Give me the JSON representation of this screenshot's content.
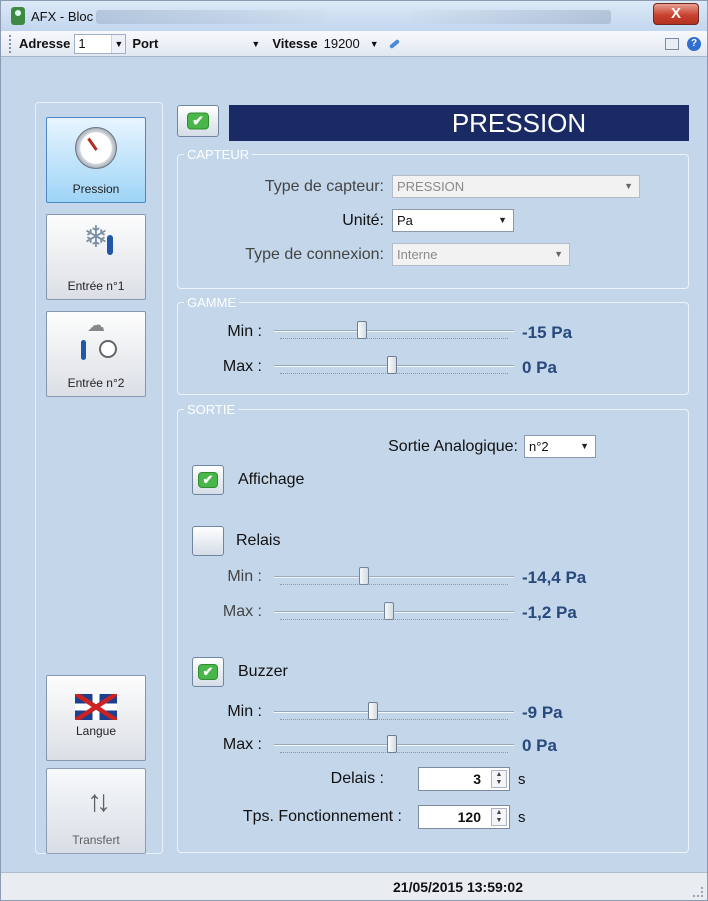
{
  "window": {
    "title": "AFX - Bloc",
    "close_label": "X"
  },
  "toolbar": {
    "adresse_label": "Adresse",
    "adresse_value": "1",
    "port_label": "Port",
    "port_value": "",
    "vitesse_label": "Vitesse",
    "vitesse_value": "19200"
  },
  "sidebar": {
    "items": [
      {
        "label": "Pression",
        "icon": "pressure-gauge-icon",
        "active": true
      },
      {
        "label": "Entrée n°1",
        "icon": "snowflake-thermometer-icon"
      },
      {
        "label": "Entrée n°2",
        "icon": "weather-thermometer-gauge-icon"
      }
    ],
    "langue_label": "Langue",
    "transfert_label": "Transfert"
  },
  "header": {
    "title": "PRESSION",
    "enabled": true
  },
  "capteur": {
    "group_title": "CAPTEUR",
    "type_capteur_label": "Type de capteur:",
    "type_capteur_value": "PRESSION",
    "unite_label": "Unité:",
    "unite_value": "Pa",
    "type_connexion_label": "Type de connexion:",
    "type_connexion_value": "Interne"
  },
  "gamme": {
    "group_title": "GAMME",
    "min_label": "Min :",
    "min_value": "-15 Pa",
    "min_position": 0.36,
    "max_label": "Max :",
    "max_value": "0 Pa",
    "max_position": 0.49
  },
  "sortie": {
    "group_title": "SORTIE",
    "analog_label": "Sortie Analogique:",
    "analog_value": "n°2",
    "affichage": {
      "label": "Affichage",
      "checked": true
    },
    "relais": {
      "label": "Relais",
      "checked": false,
      "min_label": "Min :",
      "min_value": "-14,4 Pa",
      "min_position": 0.37,
      "max_label": "Max :",
      "max_value": "-1,2 Pa",
      "max_position": 0.48
    },
    "buzzer": {
      "label": "Buzzer",
      "checked": true,
      "min_label": "Min :",
      "min_value": "-9 Pa",
      "min_position": 0.41,
      "max_label": "Max :",
      "max_value": "0 Pa",
      "max_position": 0.49
    },
    "delais_label": "Delais :",
    "delais_value": "3",
    "delais_unit": "s",
    "tps_label": "Tps. Fonctionnement :",
    "tps_value": "120",
    "tps_unit": "s"
  },
  "status": {
    "datetime": "21/05/2015  13:59:02"
  },
  "colors": {
    "title_bg": "#192a65",
    "value_text": "#27497c",
    "panel_bg": "#c4d6ea",
    "check_green": "#49b649"
  }
}
